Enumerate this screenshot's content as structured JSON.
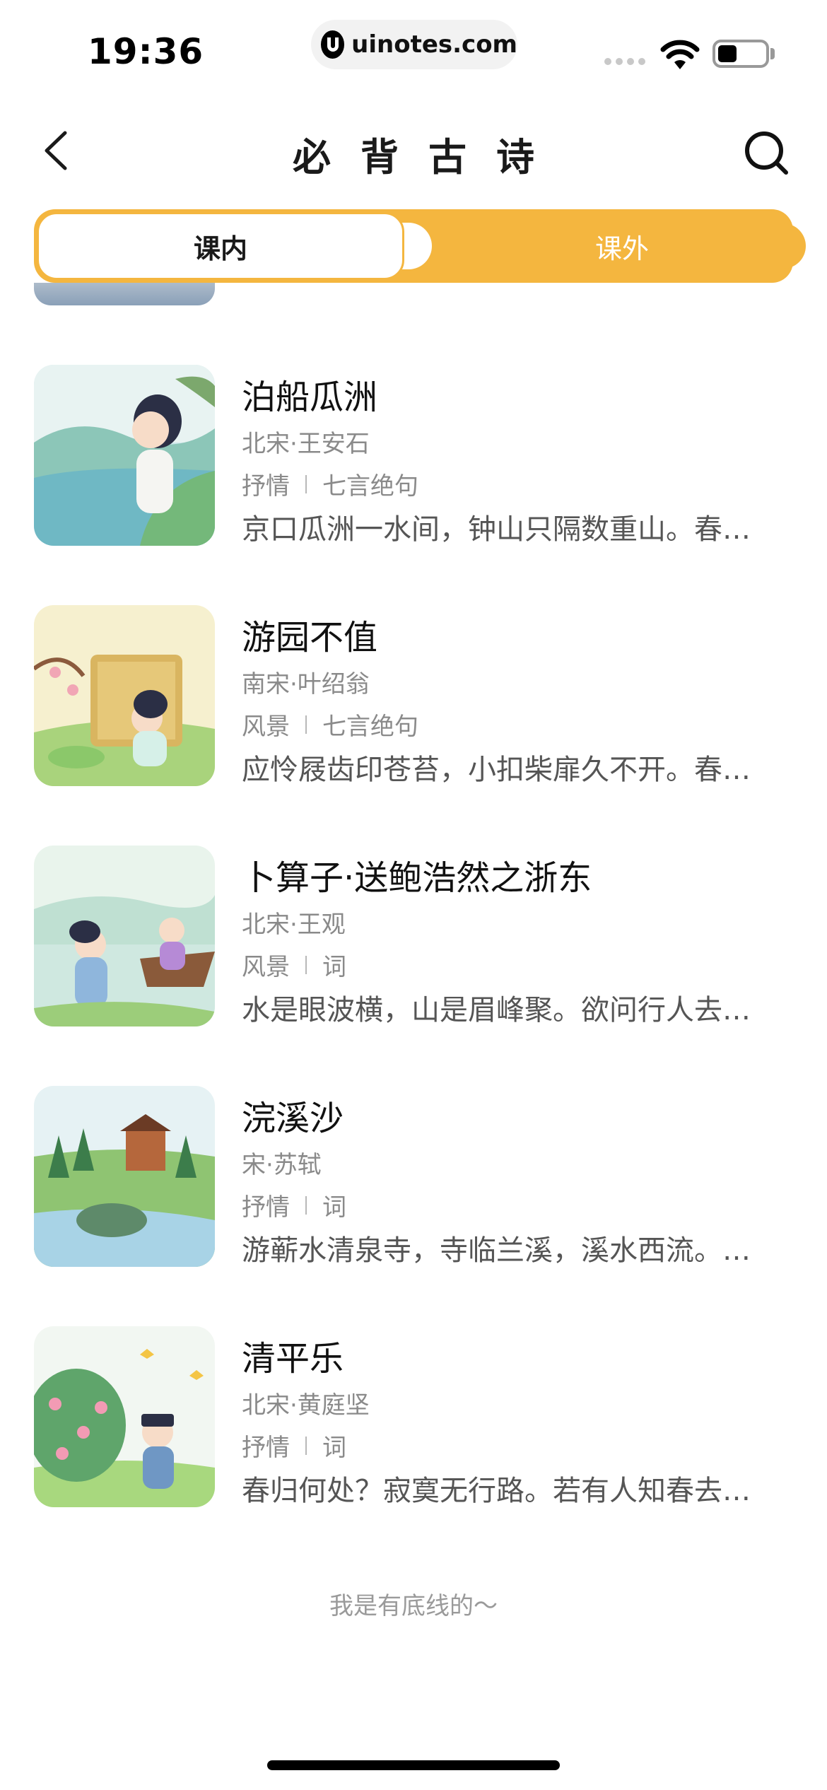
{
  "status": {
    "time": "19:36",
    "url": "uinotes.com"
  },
  "nav": {
    "title": "必背古诗"
  },
  "tabs": [
    {
      "label": "课内",
      "active": true
    },
    {
      "label": "课外",
      "active": false
    }
  ],
  "colors": {
    "accent": "#f4b63f"
  },
  "partial_row": {
    "excerpt": "...................."
  },
  "poems": [
    {
      "title": "泊船瓜洲",
      "author": "北宋·王安石",
      "category": "抒情",
      "form": "七言绝句",
      "excerpt": "京口瓜洲一水间，钟山只隔数重山。春…",
      "image": "scholar-by-river-illustration"
    },
    {
      "title": "游园不值",
      "author": "南宋·叶绍翁",
      "category": "风景",
      "form": "七言绝句",
      "excerpt": "应怜屐齿印苍苔，小扣柴扉久不开。春…",
      "image": "scholar-at-bamboo-gate-illustration"
    },
    {
      "title": "卜算子·送鲍浩然之浙东",
      "author": "北宋·王观",
      "category": "风景",
      "form": "词",
      "excerpt": "水是眼波横，山是眉峰聚。欲问行人去…",
      "image": "farewell-by-boat-illustration"
    },
    {
      "title": "浣溪沙",
      "author": "宋·苏轼",
      "category": "抒情",
      "form": "词",
      "excerpt": "游蕲水清泉寺，寺临兰溪，溪水西流。…",
      "image": "temple-by-stream-illustration"
    },
    {
      "title": "清平乐",
      "author": "北宋·黄庭坚",
      "category": "抒情",
      "form": "词",
      "excerpt": "春归何处？寂寞无行路。若有人知春去…",
      "image": "scholar-with-birds-illustration"
    }
  ],
  "footer": {
    "note": "我是有底线的～"
  }
}
